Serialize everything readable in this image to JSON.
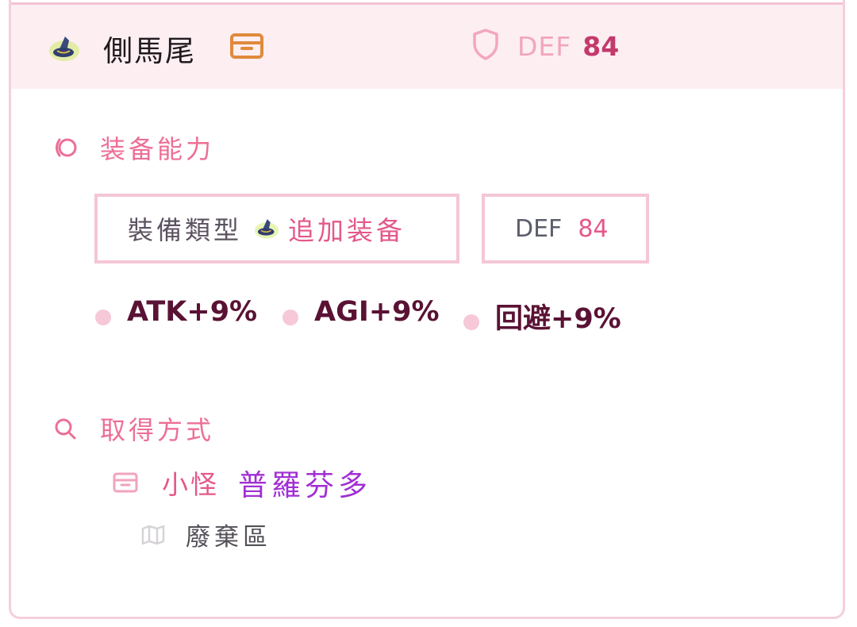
{
  "item": {
    "name": "側馬尾",
    "icon": "witch-hat-icon",
    "source_type_icon": "chest-icon",
    "def_icon": "shield-icon",
    "def_label": "DEF",
    "def_value": "84"
  },
  "abilities_section": {
    "icon": "swirl-icon",
    "title": "装备能力",
    "equip_type_label": "裝備類型",
    "equip_type_icon": "witch-hat-icon",
    "equip_type_value": "追加装备",
    "def_label": "DEF",
    "def_value": "84",
    "stats": [
      "ATK+9%",
      "AGI+9%",
      "回避+9%"
    ]
  },
  "source_section": {
    "icon": "search-icon",
    "title": "取得方式",
    "sources": [
      {
        "type_icon": "chest-icon",
        "type": "小怪",
        "name": "普羅芬多",
        "map_icon": "map-icon",
        "map": "廢棄區"
      }
    ]
  },
  "colors": {
    "header_bg": "#fdeef2",
    "border": "#f5cfdc",
    "accent_pink": "#e4588a",
    "stat_text": "#5a1234",
    "monster_purple": "#a12fd4"
  }
}
